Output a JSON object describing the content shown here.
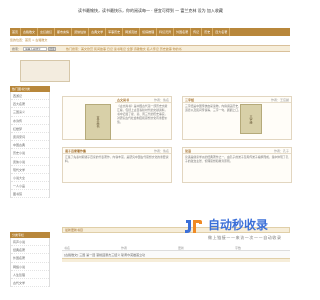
{
  "header": {
    "tagline": "读书最愉快，读书最快乐，你的阅读每一 · 便宜可得到 — 富兰克林 设为 加入收藏"
  },
  "nav": {
    "items": [
      "首页",
      "古籍散文",
      "玄幻魔幻",
      "都市言情",
      "武侠仙侠",
      "古典文学",
      "军事历史",
      "网游竞技",
      "侦探推理",
      "科幻灵异",
      "外国名著",
      "传记",
      "历史",
      "四大名著"
    ]
  },
  "breadcrumb": "您的位置：首页 > 古籍散文",
  "search": {
    "label": "搜索：",
    "placeholder": "请输入关键字",
    "button": "搜索",
    "hot": "热门搜索：美文欣赏 民间故事 日记 读书笔记 全部 诗歌散文 名人传记 历史故事 你的书"
  },
  "sidebar": {
    "title": "热门图书分类",
    "items": [
      "西游记",
      "四大名著",
      "三国演义",
      "水浒传",
      "红楼梦",
      "唐诗宋词",
      "中国古典",
      "历史小说",
      "武侠小说",
      "现代文学",
      "小说大全",
      "一人小品",
      "图书馆"
    ],
    "title2": "分类专栏",
    "items2": [
      "有声小说",
      "经典名著",
      "外国名著",
      "网络小说",
      "人生哲理",
      "古代文学"
    ]
  },
  "books": [
    {
      "title": "古文尚书",
      "author": "作者：佚名",
      "desc": "《古文尚书》是中国古代第一部历史文献汇编，包括上古至春秋时代的文献资料，书中记载了夏、商、周三代的历史事实，对研究古代社会制度和思想文化有重要价值。"
    },
    {
      "title": "三字经",
      "author": "作者：王应麟",
      "desc": "三字经是中国传统启蒙读物，内容涵盖历史、天文、地理、道德以及民间传说等，三字一句，朗朗上口，广为流传。"
    },
    {
      "title": "诸子百家著作集",
      "author": "作者：佚名",
      "desc": "汇集了先秦时期诸子百家的代表著作，内容丰富，是研究中国古代思想文化的重要资料。"
    },
    {
      "title": "论语",
      "author": "作者：孔子",
      "desc": "论语是儒家学派的经典著作之一，由孔子的弟子及再传弟子编撰而成，集中体现了孔子的政治主张、伦理思想和教育原则。"
    }
  ],
  "section": {
    "title": "最新更新书目",
    "columns": [
      "书名",
      "作者",
      "更新",
      "字数"
    ],
    "row": "[古籍散文] 三国 第一回 宴桃园豪杰三结义 斩黄巾英雄首立功"
  },
  "watermark": {
    "title": "自动秒收录",
    "subtitle": "做上链接——来访一次——自动收录"
  },
  "colors": {
    "accent": "#b8873b",
    "watermark_blue": "#3b6fd8",
    "watermark_orange": "#f08a24"
  }
}
